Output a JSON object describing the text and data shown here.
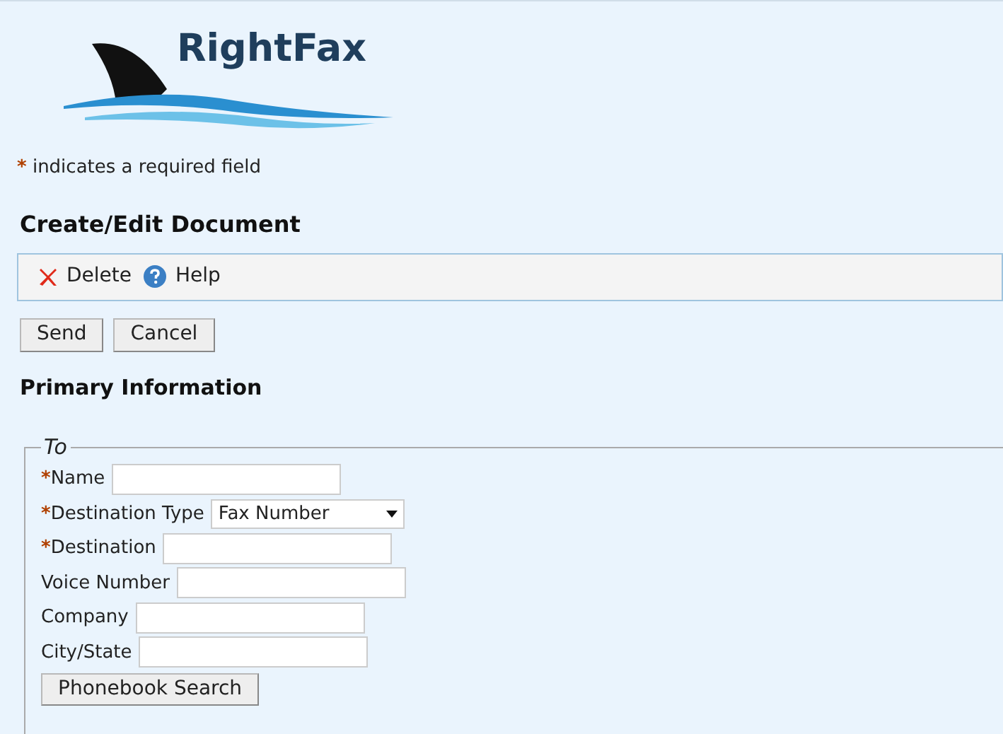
{
  "logo": {
    "text": "RightFax"
  },
  "required_note": {
    "mark": "*",
    "text": "indicates a required field"
  },
  "title": "Create/Edit Document",
  "toolbar": [
    {
      "kind": "delete",
      "label": "Delete"
    },
    {
      "kind": "help",
      "label": "Help"
    }
  ],
  "buttons": [
    "Send",
    "Cancel"
  ],
  "section_title": "Primary Information",
  "fieldset": {
    "legend": "To",
    "fields": [
      {
        "kind": "text",
        "label": "Name",
        "required_mark": "*"
      },
      {
        "kind": "select",
        "label": "Destination Type",
        "required_mark": "*",
        "value": "Fax Number"
      },
      {
        "kind": "text",
        "label": "Destination",
        "required_mark": "*"
      },
      {
        "kind": "text",
        "label": "Voice Number"
      },
      {
        "kind": "text",
        "label": "Company"
      },
      {
        "kind": "text",
        "label": "City/State"
      }
    ],
    "button": "Phonebook Search"
  }
}
